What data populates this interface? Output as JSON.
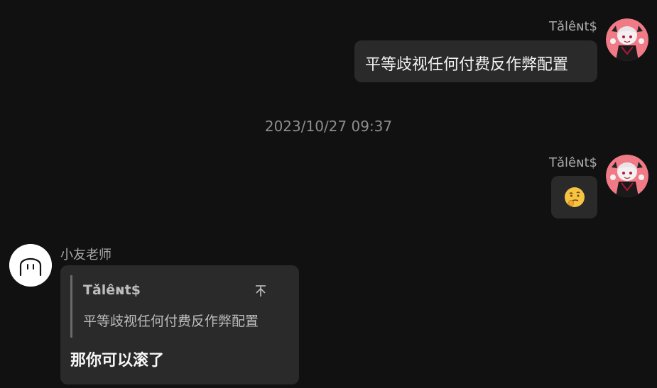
{
  "messages": [
    {
      "sender": "Tǎlêɴt$",
      "text": "平等歧视任何付费反作弊配置",
      "outgoing": true
    },
    {
      "sender": "Tǎlêɴt$",
      "emoji_icon": "thinking-face-icon",
      "outgoing": true
    },
    {
      "sender": "小友老师",
      "quote": {
        "author": "Tǎlêɴt$",
        "text": "平等歧视任何付费反作弊配置"
      },
      "text": "那你可以滚了",
      "outgoing": false
    }
  ],
  "timestamp": "2023/10/27 09:37",
  "colors": {
    "background": "#111111",
    "bubble": "#2a2a2a",
    "name_text": "#a9a9a9",
    "timestamp_text": "#8e8e8e",
    "avatar_pink": "#f07b86"
  }
}
